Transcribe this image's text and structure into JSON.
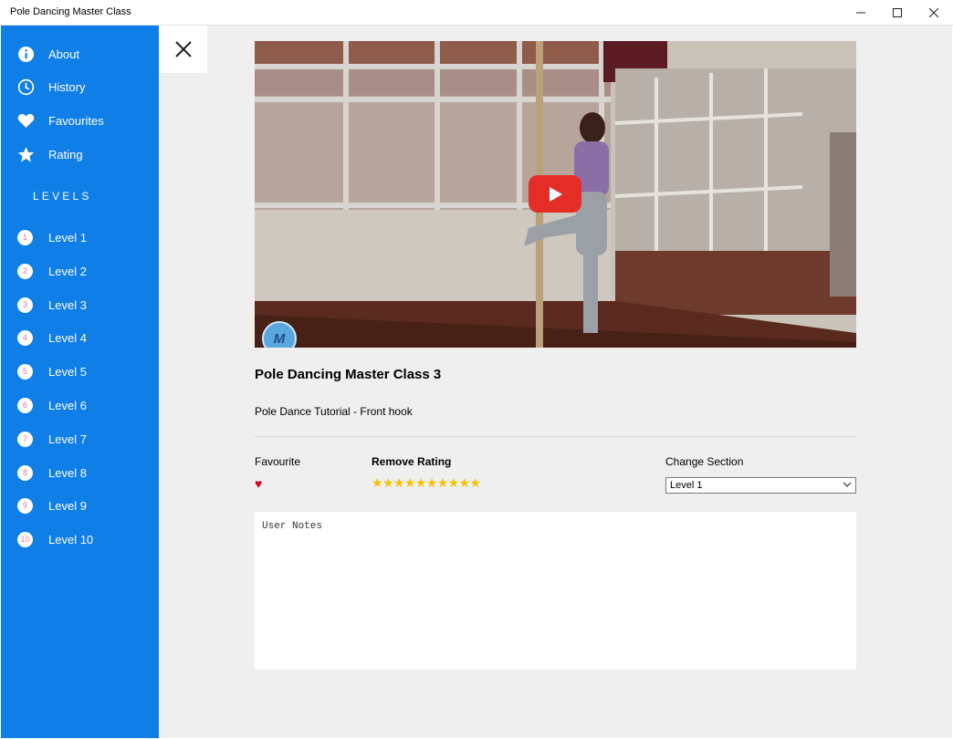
{
  "window": {
    "title": "Pole Dancing Master Class",
    "minimize": "—",
    "maximize": "☐",
    "close": "✕"
  },
  "sidebar": {
    "menu": [
      {
        "label": "About",
        "icon": "info-icon"
      },
      {
        "label": "History",
        "icon": "clock-icon"
      },
      {
        "label": "Favourites",
        "icon": "heart-icon"
      },
      {
        "label": "Rating",
        "icon": "star-icon"
      }
    ],
    "levels_heading": "LEVELS",
    "levels": [
      {
        "num": "1",
        "label": "Level 1"
      },
      {
        "num": "2",
        "label": "Level 2"
      },
      {
        "num": "3",
        "label": "Level 3"
      },
      {
        "num": "4",
        "label": "Level 4"
      },
      {
        "num": "5",
        "label": "Level 5"
      },
      {
        "num": "6",
        "label": "Level 6"
      },
      {
        "num": "7",
        "label": "Level 7"
      },
      {
        "num": "8",
        "label": "Level 8"
      },
      {
        "num": "9",
        "label": "Level 9"
      },
      {
        "num": "10",
        "label": "Level 10"
      }
    ],
    "color": "#0f7ee6"
  },
  "video": {
    "title": "Pole Dancing Master Class 3",
    "description": "Pole Dance Tutorial - Front hook",
    "channel_logo": "M"
  },
  "controls": {
    "favourite_label": "Favourite",
    "favourite_icon": "♥",
    "rating_label": "Remove Rating",
    "stars": "★★★★★★★★★★",
    "rating_value": 10,
    "section_label": "Change Section",
    "section_value": "Level 1"
  },
  "notes": {
    "placeholder": "User Notes"
  }
}
